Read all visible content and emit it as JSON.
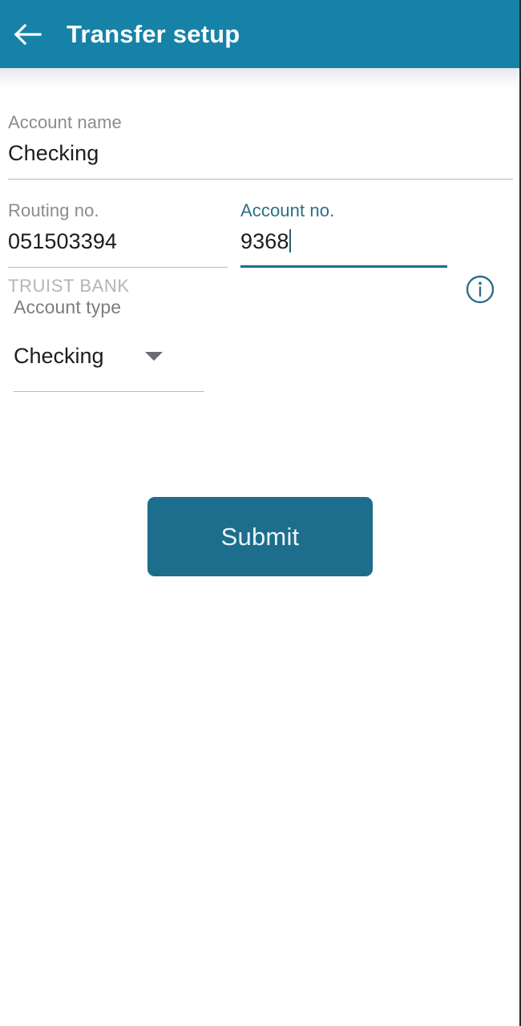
{
  "appbar": {
    "title": "Transfer setup",
    "back_icon": "arrow-left-icon",
    "background_color": "#1682a8"
  },
  "form": {
    "account_name": {
      "label": "Account name",
      "value": "Checking",
      "focused": false
    },
    "routing_number": {
      "label": "Routing no.",
      "value": "051503394",
      "helper_text": "TRUIST BANK",
      "focused": false
    },
    "account_number": {
      "label": "Account no.",
      "value": "9368",
      "focused": true,
      "label_color": "#2e6e86",
      "underline_color": "#1a6e8e"
    },
    "info": {
      "icon": "info-circle-icon",
      "color": "#2e6e86"
    },
    "account_type": {
      "label": "Account type",
      "value": "Checking",
      "caret_icon": "chevron-down-icon"
    }
  },
  "actions": {
    "submit_label": "Submit",
    "submit_color": "#1c6e8c"
  }
}
